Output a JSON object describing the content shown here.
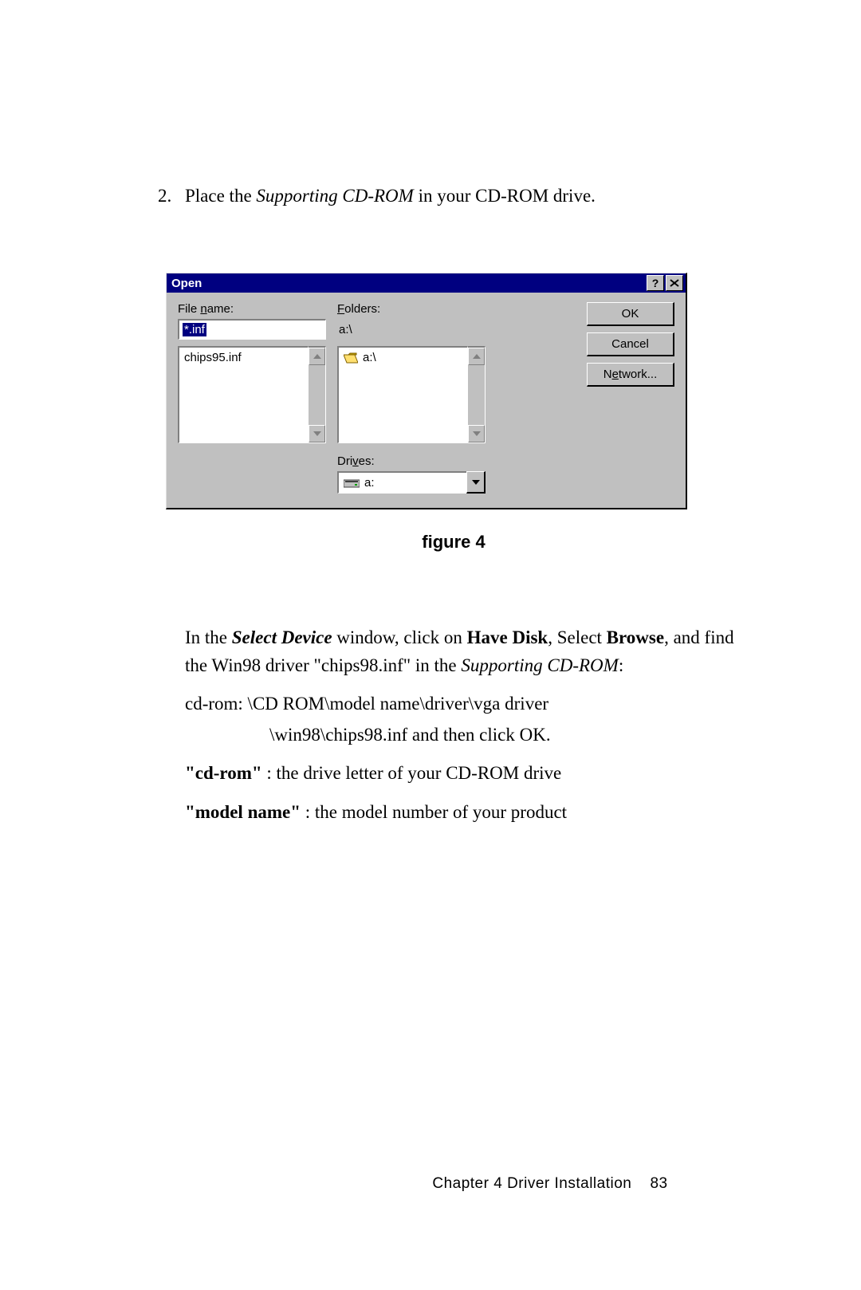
{
  "step": {
    "number": "2.",
    "text_before": "Place the ",
    "italic": "Supporting CD-ROM",
    "text_after": " in your CD-ROM drive."
  },
  "dialog": {
    "title": "Open",
    "file_name_label_pre": "File ",
    "file_name_label_u": "n",
    "file_name_label_post": "ame:",
    "file_name_value": "*.inf",
    "folders_label_u": "F",
    "folders_label_post": "olders:",
    "folders_path": "a:\\",
    "file_list_item": "chips95.inf",
    "folder_list_item": "a:\\",
    "drives_label_pre": "Dri",
    "drives_label_u": "v",
    "drives_label_post": "es:",
    "drives_value": "a:",
    "ok": "OK",
    "cancel": "Cancel",
    "network_pre": "N",
    "network_u": "e",
    "network_post": "twork..."
  },
  "caption": "figure 4",
  "body": {
    "p1_a": "In the ",
    "p1_b": "Select Device",
    "p1_c": " window, click on ",
    "p1_d": "Have Disk",
    "p1_e": ", Select ",
    "p1_f": "Browse",
    "p1_g": ", and find the Win98 driver \"chips98.inf\" in the ",
    "p1_h": "Supporting CD-ROM",
    "p1_i": ":",
    "p2": "cd-rom: \\CD ROM\\model name\\driver\\vga driver",
    "p2b": "\\win98\\chips98.inf and then click OK.",
    "p3_a": "\"cd-rom\"",
    "p3_b": " :  the drive letter of your CD-ROM drive",
    "p4_a": "\"model name\"",
    "p4_b": "   :  the model number of your product"
  },
  "footer": {
    "chapter": "Chapter 4  Driver Installation",
    "page": "83"
  }
}
